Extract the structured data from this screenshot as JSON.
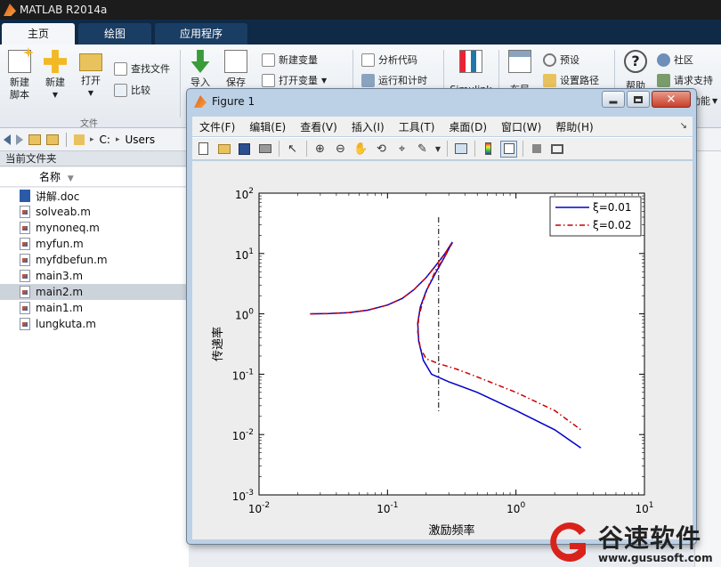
{
  "window": {
    "title": "MATLAB R2014a"
  },
  "tabs": [
    {
      "label": "主页",
      "active": true
    },
    {
      "label": "绘图",
      "active": false
    },
    {
      "label": "应用程序",
      "active": false
    }
  ],
  "ribbon": {
    "new_script": "新建\n脚本",
    "new": "新建",
    "open": "打开",
    "find_files": "查找文件",
    "compare": "比较",
    "group_file": "文件",
    "import": "导入",
    "save": "保存",
    "new_variable": "新建变量",
    "open_variable": "打开变量",
    "analyze_code": "分析代码",
    "run_and_time": "运行和计时",
    "simulink": "Simulink",
    "layout": "布局",
    "preferences": "预设",
    "set_path": "设置路径",
    "help": "帮助",
    "community": "社区",
    "request_support": "请求支持",
    "addons": "功能"
  },
  "pathbar": {
    "drive": "C:",
    "sep": "▸",
    "folder": "Users"
  },
  "file_browser": {
    "panel_title": "当前文件夹",
    "column_name": "名称",
    "files": [
      {
        "name": "讲解.doc",
        "type": "doc",
        "selected": false
      },
      {
        "name": "solveab.m",
        "type": "m",
        "selected": false
      },
      {
        "name": "mynoneq.m",
        "type": "m",
        "selected": false
      },
      {
        "name": "myfun.m",
        "type": "m",
        "selected": false
      },
      {
        "name": "myfdbefun.m",
        "type": "m",
        "selected": false
      },
      {
        "name": "main3.m",
        "type": "m",
        "selected": false
      },
      {
        "name": "main2.m",
        "type": "m",
        "selected": true
      },
      {
        "name": "main1.m",
        "type": "m",
        "selected": false
      },
      {
        "name": "lungkuta.m",
        "type": "m",
        "selected": false
      }
    ]
  },
  "figure": {
    "title": "Figure 1",
    "menu": [
      "文件(F)",
      "编辑(E)",
      "查看(V)",
      "插入(I)",
      "工具(T)",
      "桌面(D)",
      "窗口(W)",
      "帮助(H)"
    ],
    "toolbar_icons": [
      "new-figure-icon",
      "open-file-icon",
      "save-icon",
      "print-icon",
      "pointer-icon",
      "zoom-in-icon",
      "zoom-out-icon",
      "pan-hand-icon",
      "rotate-3d-icon",
      "data-cursor-icon",
      "brush-icon",
      "link-plot-icon",
      "colorbar-icon",
      "legend-icon",
      "hide-plot-tools-icon",
      "show-plot-tools-icon"
    ]
  },
  "chart_data": {
    "type": "line",
    "title": "",
    "xlabel": "激励频率",
    "ylabel": "传递率",
    "xscale": "log",
    "yscale": "log",
    "xlim": [
      0.01,
      10
    ],
    "ylim": [
      0.001,
      100
    ],
    "x_ticks": [
      0.01,
      0.1,
      1,
      10
    ],
    "y_ticks": [
      0.001,
      0.01,
      0.1,
      1,
      10,
      100
    ],
    "x_tick_labels": [
      {
        "base": "10",
        "exp": "-2"
      },
      {
        "base": "10",
        "exp": "-1"
      },
      {
        "base": "10",
        "exp": "0"
      },
      {
        "base": "10",
        "exp": "1"
      }
    ],
    "y_tick_labels": [
      {
        "base": "10",
        "exp": "-3"
      },
      {
        "base": "10",
        "exp": "-2"
      },
      {
        "base": "10",
        "exp": "-1"
      },
      {
        "base": "10",
        "exp": "0"
      },
      {
        "base": "10",
        "exp": "1"
      },
      {
        "base": "10",
        "exp": "2"
      }
    ],
    "legend_position": "top-right",
    "series": [
      {
        "name": "ξ=0.01",
        "color": "#0000cc",
        "style": "solid",
        "x": [
          0.025,
          0.035,
          0.05,
          0.07,
          0.1,
          0.13,
          0.16,
          0.2,
          0.24,
          0.28,
          0.32,
          0.28,
          0.24,
          0.2,
          0.18,
          0.172,
          0.175,
          0.19,
          0.22,
          0.3,
          0.5,
          1.0,
          2.0,
          3.2
        ],
        "y": [
          1.0,
          1.01,
          1.05,
          1.15,
          1.4,
          1.8,
          2.5,
          4.0,
          6.5,
          10.0,
          15.5,
          9.0,
          5.0,
          2.4,
          1.3,
          0.7,
          0.35,
          0.17,
          0.1,
          0.075,
          0.05,
          0.025,
          0.012,
          0.006
        ]
      },
      {
        "name": "ξ=0.02",
        "color": "#cc0000",
        "style": "dashdot",
        "x": [
          0.025,
          0.035,
          0.05,
          0.07,
          0.1,
          0.13,
          0.16,
          0.2,
          0.24,
          0.28,
          0.32,
          0.28,
          0.24,
          0.21,
          0.19,
          0.175,
          0.172,
          0.18,
          0.2,
          0.25,
          0.35,
          0.5,
          1.0,
          2.0,
          3.2
        ],
        "y": [
          1.0,
          1.01,
          1.05,
          1.15,
          1.4,
          1.8,
          2.5,
          4.0,
          6.5,
          10.0,
          15.0,
          9.0,
          5.5,
          3.0,
          1.7,
          0.9,
          0.5,
          0.27,
          0.18,
          0.15,
          0.12,
          0.09,
          0.05,
          0.025,
          0.012
        ]
      }
    ],
    "vline_x": 0.25
  },
  "watermark": {
    "text": "谷速软件",
    "url": "www.gususoft.com"
  }
}
